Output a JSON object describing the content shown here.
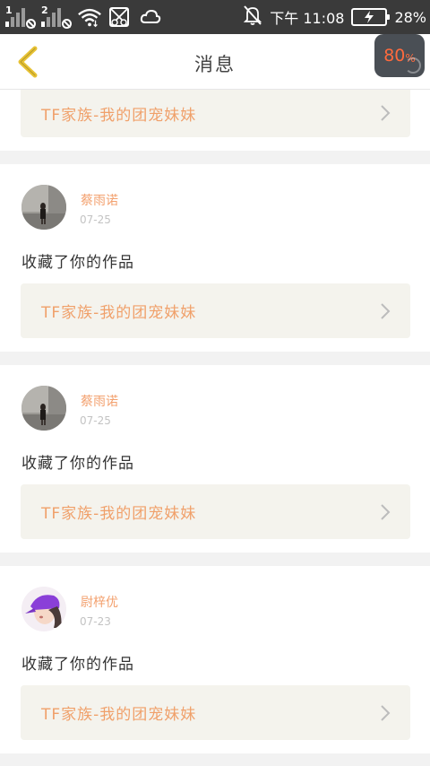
{
  "status_bar": {
    "sim1": "1",
    "sim2": "2",
    "time": "下午 11:08",
    "battery": "28%",
    "icons": [
      "signal-sim1-icon",
      "signal-sim2-icon",
      "wifi-icon",
      "no-sim-icon",
      "cloud-icon",
      "alarm-off-icon",
      "battery-icon"
    ]
  },
  "header": {
    "title": "消息",
    "back_icon": "chevron-left-icon",
    "boost_value": "80",
    "boost_unit": "%"
  },
  "colors": {
    "accent_orange": "#f3a06e",
    "link_bg": "#f4f3ed",
    "page_bg": "#f2f2f2",
    "back_icon": "#e7c234"
  },
  "feed": {
    "partial_item": {
      "work_title": "TF家族-我的团宠妹妹"
    },
    "items": [
      {
        "username": "蔡雨诺",
        "date": "07-25",
        "action": "收藏了你的作品",
        "work_title": "TF家族-我的团宠妹妹",
        "avatar": "avatar-photo-street"
      },
      {
        "username": "蔡雨诺",
        "date": "07-25",
        "action": "收藏了你的作品",
        "work_title": "TF家族-我的团宠妹妹",
        "avatar": "avatar-photo-street"
      },
      {
        "username": "尉梓优",
        "date": "07-23",
        "action": "收藏了你的作品",
        "work_title": "TF家族-我的团宠妹妹",
        "avatar": "avatar-photo-purple-cap"
      }
    ]
  }
}
